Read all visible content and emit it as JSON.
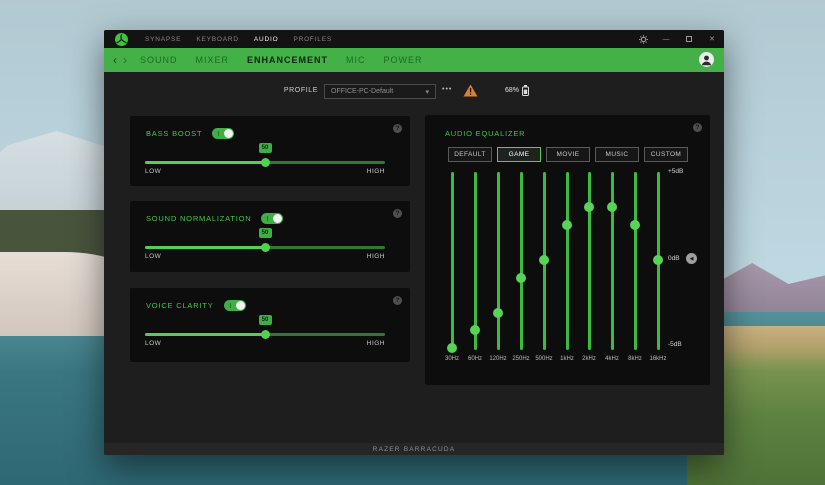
{
  "colors": {
    "razer_green": "#43b148",
    "accent_green": "#4bd34b",
    "warning_orange": "#d9822b",
    "panel_bg": "#0d0d0d",
    "content_bg": "#1e1e1e"
  },
  "icons": {
    "back": "‹",
    "forward": "›",
    "dropdown": "▾",
    "more": "•••",
    "minimize": "—",
    "close": "✕",
    "reset": "◀",
    "info": "?"
  },
  "window": {
    "titlebar": {
      "menu": [
        "SYNAPSE",
        "KEYBOARD",
        "AUDIO",
        "PROFILES"
      ],
      "active_menu": "AUDIO"
    },
    "nav": {
      "tabs": [
        "SOUND",
        "MIXER",
        "ENHANCEMENT",
        "MIC",
        "POWER"
      ],
      "active_tab": "ENHANCEMENT"
    },
    "profile": {
      "label": "PROFILE",
      "selected": "OFFICE-PC-Default",
      "battery_percent": "68%"
    },
    "panels": [
      {
        "title": "BASS BOOST",
        "enabled": true,
        "value": "50",
        "percent": 50,
        "low_label": "LOW",
        "high_label": "HIGH"
      },
      {
        "title": "SOUND NORMALIZATION",
        "enabled": true,
        "value": "50",
        "percent": 50,
        "low_label": "LOW",
        "high_label": "HIGH"
      },
      {
        "title": "VOICE CLARITY",
        "enabled": true,
        "value": "50",
        "percent": 50,
        "low_label": "LOW",
        "high_label": "HIGH"
      }
    ],
    "equalizer": {
      "title": "AUDIO EQUALIZER",
      "presets": [
        "DEFAULT",
        "GAME",
        "MOVIE",
        "MUSIC",
        "CUSTOM"
      ],
      "active_preset": "GAME",
      "scale": {
        "top": "+5dB",
        "mid": "0dB",
        "bottom": "-5dB"
      },
      "bands": [
        {
          "label": "30Hz",
          "db": -5
        },
        {
          "label": "60Hz",
          "db": -4
        },
        {
          "label": "120Hz",
          "db": -3
        },
        {
          "label": "250Hz",
          "db": -1
        },
        {
          "label": "500Hz",
          "db": 0
        },
        {
          "label": "1kHz",
          "db": 2
        },
        {
          "label": "2kHz",
          "db": 3
        },
        {
          "label": "4kHz",
          "db": 3
        },
        {
          "label": "8kHz",
          "db": 2
        },
        {
          "label": "16kHz",
          "db": 0
        }
      ]
    },
    "footer": "RAZER BARRACUDA"
  }
}
